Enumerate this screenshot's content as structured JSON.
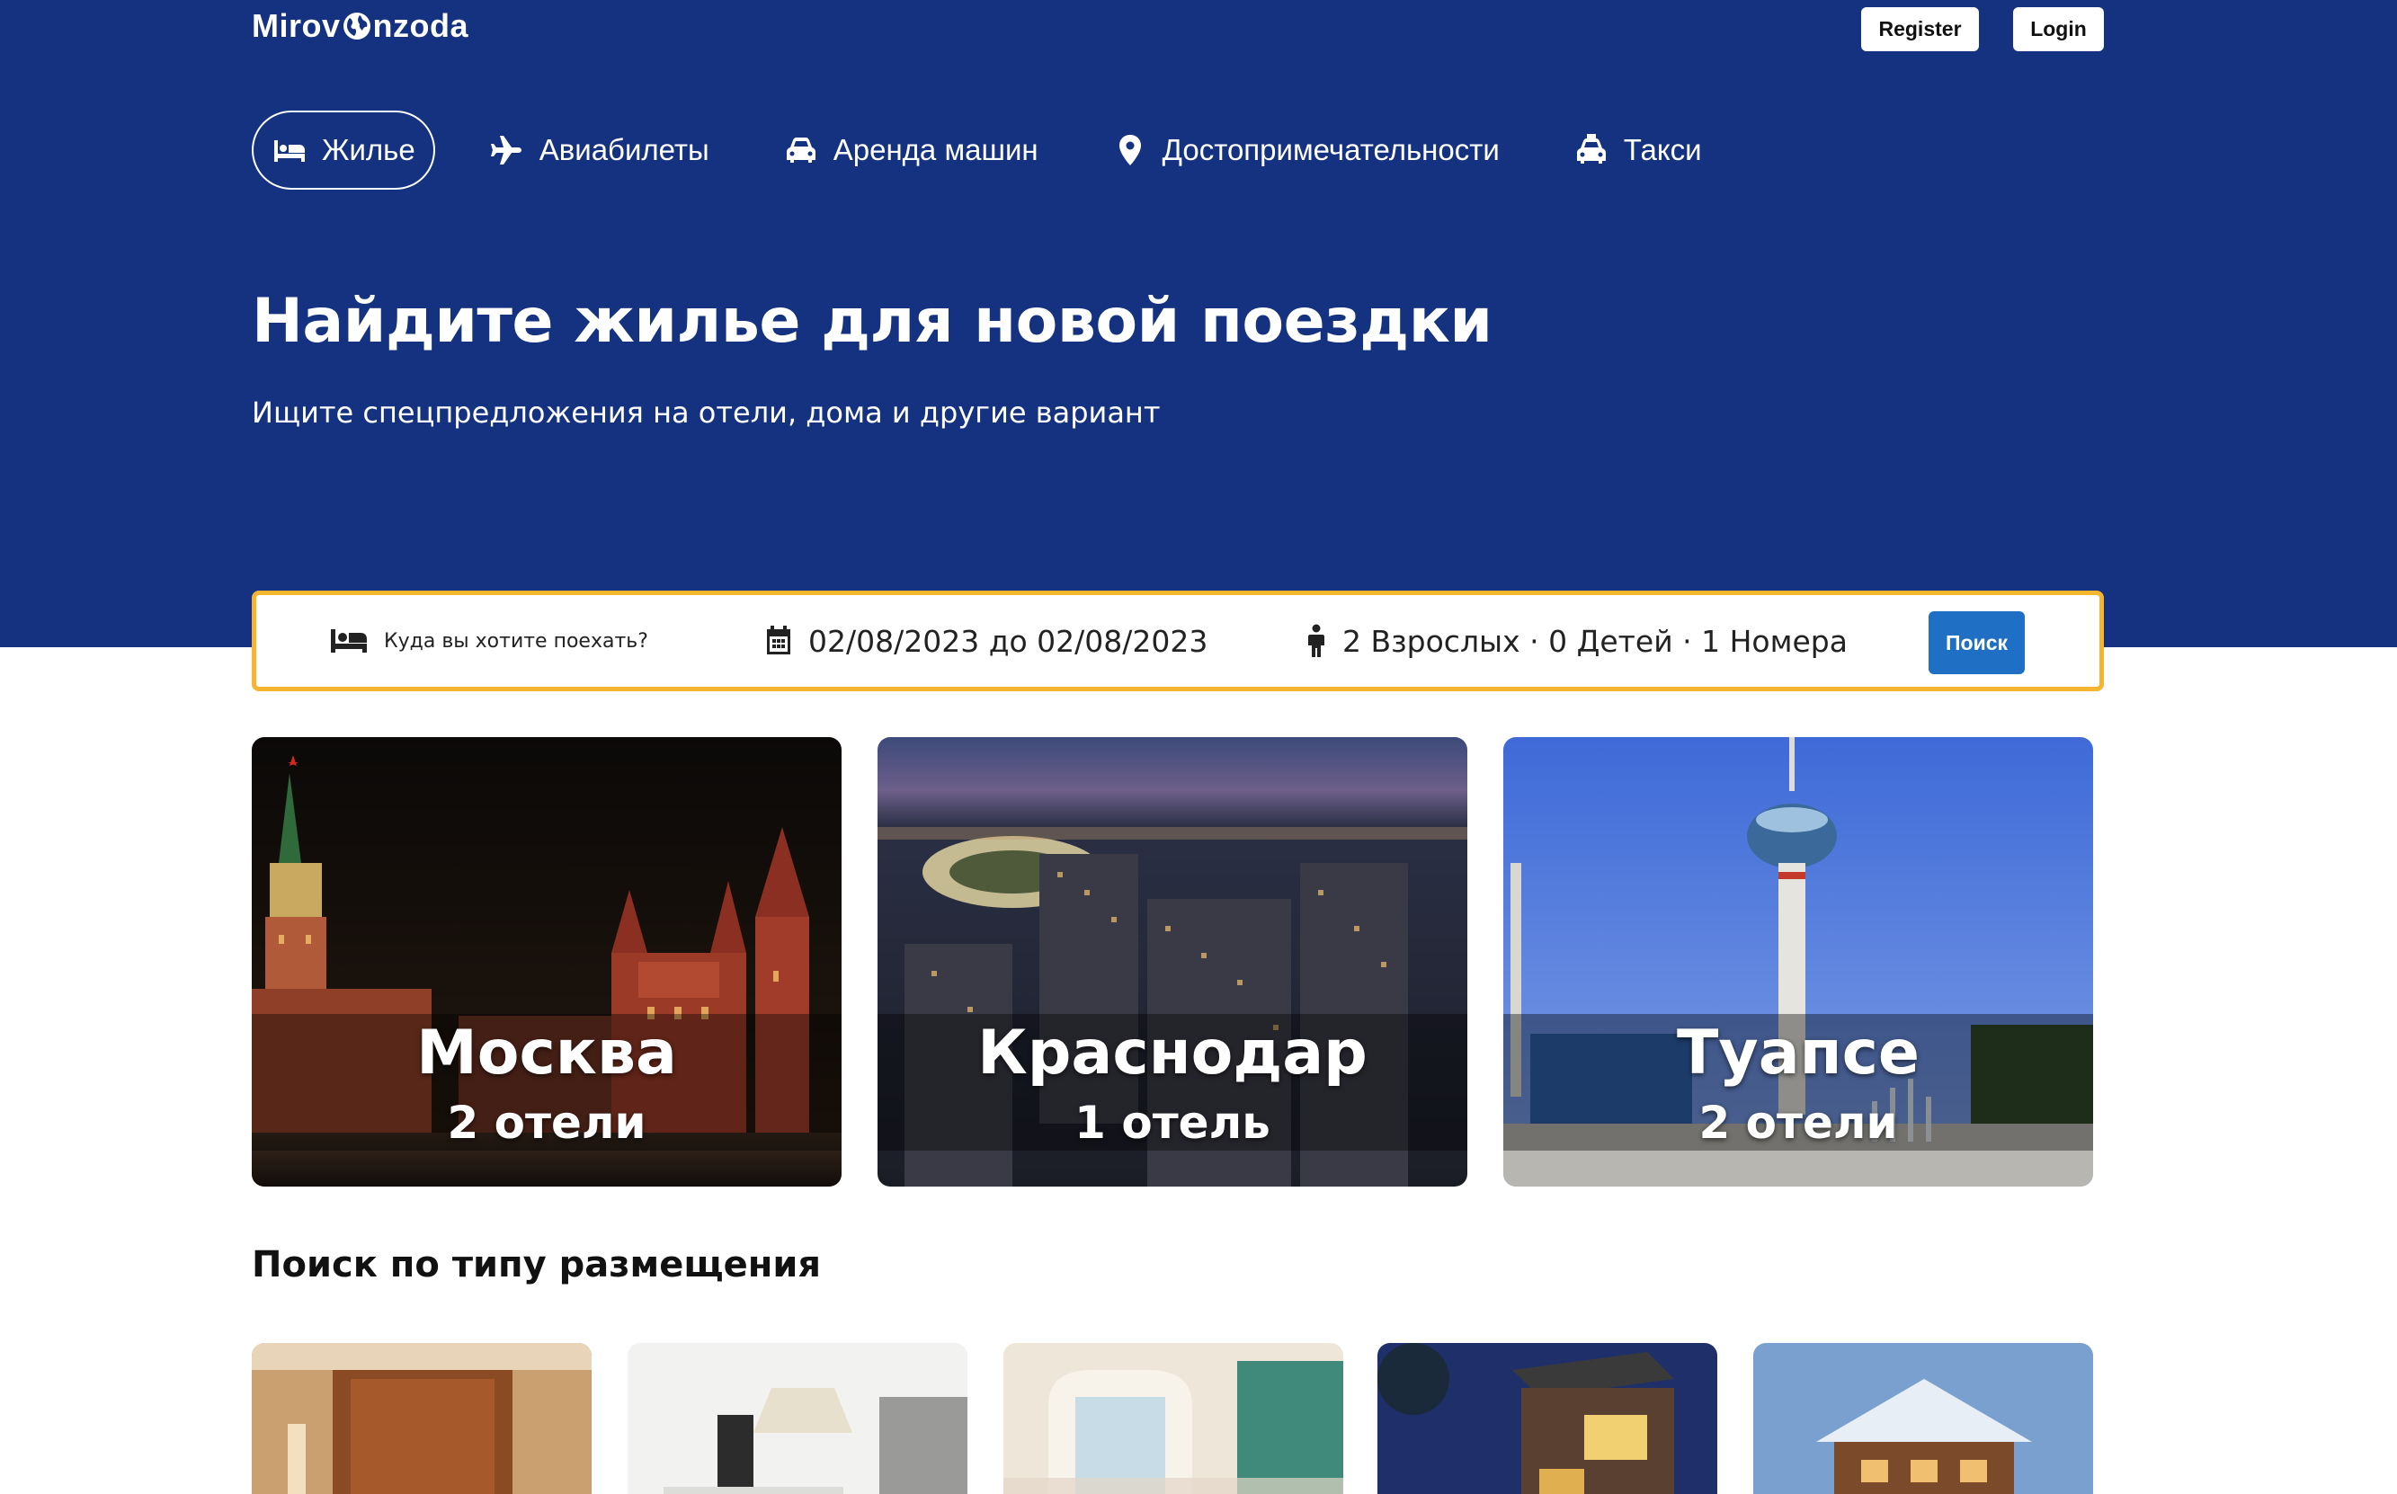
{
  "brand": {
    "logo_text_left": "Mirov",
    "logo_text_right": "nzoda"
  },
  "auth": {
    "register_label": "Register",
    "login_label": "Login"
  },
  "nav": {
    "items": [
      {
        "label": "Жилье",
        "icon": "bed-icon",
        "active": true
      },
      {
        "label": "Авиабилеты",
        "icon": "plane-icon",
        "active": false
      },
      {
        "label": "Аренда машин",
        "icon": "car-icon",
        "active": false
      },
      {
        "label": "Достопримечательности",
        "icon": "map-pin-icon",
        "active": false
      },
      {
        "label": "Такси",
        "icon": "taxi-icon",
        "active": false
      }
    ]
  },
  "hero": {
    "title": "Найдите жилье для новой поездки",
    "subtitle": "Ищите спецпредложения на отели, дома и другие вариант"
  },
  "search": {
    "destination_placeholder": "Куда вы хотите поехать?",
    "dates": "02/08/2023 до 02/08/2023",
    "guests": "2 Взрослых · 0 Детей · 1 Номера",
    "button_label": "Поиск"
  },
  "cities": [
    {
      "name": "Москва",
      "count": "2 отели"
    },
    {
      "name": "Краснодар",
      "count": "1 отель"
    },
    {
      "name": "Туапсе",
      "count": "2 отели"
    }
  ],
  "property_types": {
    "title": "Поиск по типу размещения"
  },
  "colors": {
    "hero_bg": "#14327f",
    "search_border": "#f5b52e",
    "search_button": "#1f6fc5"
  }
}
